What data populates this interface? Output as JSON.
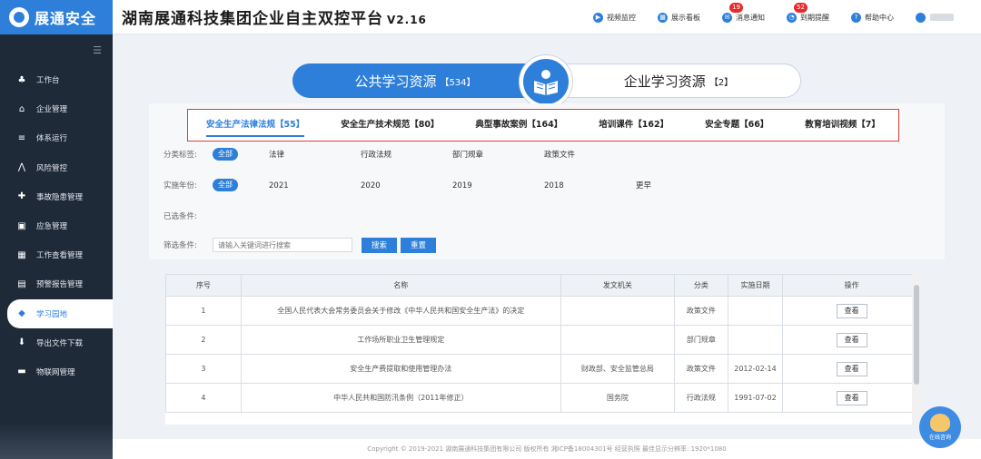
{
  "brand": {
    "logo_text": "展通安全"
  },
  "header": {
    "title": "湖南展通科技集团企业自主双控平台",
    "version": "V2.16",
    "actions": [
      {
        "label": "视频监控",
        "icon": "video-icon",
        "badge": ""
      },
      {
        "label": "展示看板",
        "icon": "dashboard-icon",
        "badge": ""
      },
      {
        "label": "消息通知",
        "icon": "message-icon",
        "badge": "19"
      },
      {
        "label": "到期提醒",
        "icon": "alarm-icon",
        "badge": "52"
      },
      {
        "label": "帮助中心",
        "icon": "help-icon",
        "badge": ""
      }
    ]
  },
  "sidebar": {
    "items": [
      {
        "label": "工作台",
        "icon": "workbench-icon",
        "active": false
      },
      {
        "label": "企业管理",
        "icon": "home-icon",
        "active": false
      },
      {
        "label": "体系运行",
        "icon": "list-icon",
        "active": false
      },
      {
        "label": "风险管控",
        "icon": "risk-icon",
        "active": false
      },
      {
        "label": "事故隐患管理",
        "icon": "hazard-icon",
        "active": false
      },
      {
        "label": "应急管理",
        "icon": "emergency-icon",
        "active": false
      },
      {
        "label": "工作查看管理",
        "icon": "calendar-icon",
        "active": false
      },
      {
        "label": "预警报告管理",
        "icon": "report-icon",
        "active": false
      },
      {
        "label": "学习园地",
        "icon": "graduation-cap-icon",
        "active": true
      },
      {
        "label": "导出文件下载",
        "icon": "download-icon",
        "active": false
      },
      {
        "label": "物联网管理",
        "icon": "iot-icon",
        "active": false
      }
    ]
  },
  "toggle": {
    "left_label": "公共学习资源",
    "left_count": "【534】",
    "right_label": "企业学习资源",
    "right_count": "【2】"
  },
  "categories": [
    {
      "label": "安全生产法律法规【55】",
      "active": true
    },
    {
      "label": "安全生产技术规范【80】",
      "active": false
    },
    {
      "label": "典型事故案例【164】",
      "active": false
    },
    {
      "label": "培训课件【162】",
      "active": false
    },
    {
      "label": "安全专题【66】",
      "active": false
    },
    {
      "label": "教育培训视频【7】",
      "active": false
    }
  ],
  "filters": {
    "tag_label": "分类标签:",
    "tag_all": "全部",
    "tags": [
      "法律",
      "行政法规",
      "部门规章",
      "政策文件"
    ],
    "year_label": "实施年份:",
    "year_all": "全部",
    "years": [
      "2021",
      "2020",
      "2019",
      "2018",
      "更早"
    ],
    "selected_label": "已选条件:",
    "search_label": "筛选条件:",
    "search_placeholder": "请输入关键词进行搜索",
    "search_button": "搜索",
    "reset_button": "重置"
  },
  "table": {
    "headers": [
      "序号",
      "名称",
      "发文机关",
      "分类",
      "实施日期",
      "操作"
    ],
    "view_label": "查看",
    "rows": [
      [
        "1",
        "全国人民代表大会常务委员会关于修改《中华人民共和国安全生产法》的决定",
        "",
        "政策文件",
        ""
      ],
      [
        "2",
        "工作场所职业卫生管理规定",
        "",
        "部门规章",
        ""
      ],
      [
        "3",
        "安全生产费提取和使用管理办法",
        "财政部、安全监管总局",
        "政策文件",
        "2012-02-14"
      ],
      [
        "4",
        "中华人民共和国防汛条例（2011年修正）",
        "国务院",
        "行政法规",
        "1991-07-02"
      ]
    ]
  },
  "footer": {
    "text": "Copyright © 2019-2021 湖南展通科技集团有限公司 版权所有 湘ICP备18004301号 经营执照   最佳显示分辨率: 1920*1080"
  },
  "assistant": {
    "label": "在线咨询"
  }
}
